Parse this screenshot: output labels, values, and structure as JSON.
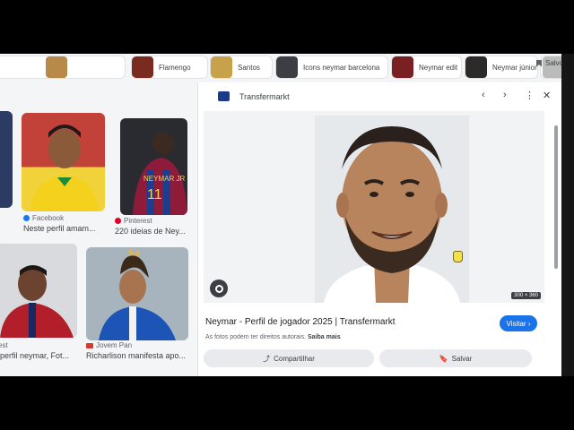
{
  "chips": [
    {
      "label": "Flamengo"
    },
    {
      "label": "Santos"
    },
    {
      "label": "Icons neymar barcelona"
    },
    {
      "label": "Neymar edit"
    },
    {
      "label": "Neymar júnior"
    }
  ],
  "saved_label": "Salvos",
  "results": [
    {
      "source": "Facebook",
      "title": "Neste perfil amam..."
    },
    {
      "source": "Pinterest",
      "title": "220 ideias de Ney..."
    },
    {
      "source": "est",
      "title": "perfil neymar, Fot..."
    },
    {
      "source": "Jovem Pan",
      "title": "Richarlison manifesta apo..."
    }
  ],
  "panel": {
    "site": "Transfermarkt",
    "title": "Neymar - Perfil de jogador 2025 | Transfermarkt",
    "rights": "As fotos podem ter direitos autorais.",
    "learn_more": "Saiba mais",
    "visit_label": "Visitar",
    "share_label": "Compartilhar",
    "save_label": "Salvar",
    "dimensions": "300 × 360"
  },
  "icons": [
    "prev-icon",
    "next-icon",
    "more-icon",
    "close-icon",
    "lens-icon",
    "share-icon",
    "bookmark-icon"
  ],
  "colors": {
    "accent": "#1a73e8",
    "background": "#f4f5f7"
  }
}
